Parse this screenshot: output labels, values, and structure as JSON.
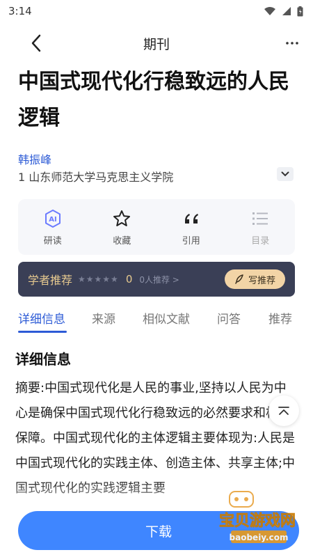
{
  "status": {
    "time": "3:14"
  },
  "nav": {
    "title": "期刊"
  },
  "article": {
    "title_line1": "中国式现代化行稳致远的人民",
    "title_line2": "逻辑",
    "author": "韩振峰",
    "affiliation": "1 山东师范大学马克思主义学院"
  },
  "actions": [
    {
      "label": "研读",
      "icon": "ai-read-icon"
    },
    {
      "label": "收藏",
      "icon": "star-icon"
    },
    {
      "label": "引用",
      "icon": "quote-icon"
    },
    {
      "label": "目录",
      "icon": "list-icon"
    }
  ],
  "recommend": {
    "title": "学者推荐",
    "score": "0",
    "count": "0人推荐 >",
    "button": "写推荐"
  },
  "tabs": [
    "详细信息",
    "来源",
    "相似文献",
    "问答",
    "推荐"
  ],
  "detail": {
    "section_title": "详细信息",
    "abstract": "摘要:中国式现代化是人民的事业,坚持以人民为中心是确保中国式现代化行稳致远的必然要求和根本保障。中国式现代化的主体逻辑主要体现为:人民是中国式现代化的实践主体、创造主体、共享主体;中国式现代化的实践逻辑主要"
  },
  "download": {
    "label": "下载"
  },
  "watermark": {
    "cn": "宝贝游戏网",
    "url": "baobeiy.com"
  },
  "colors": {
    "accent": "#3f86ff",
    "link": "#2d5bd6",
    "banner": "#3a3f56",
    "gold": "#e6c98f"
  }
}
